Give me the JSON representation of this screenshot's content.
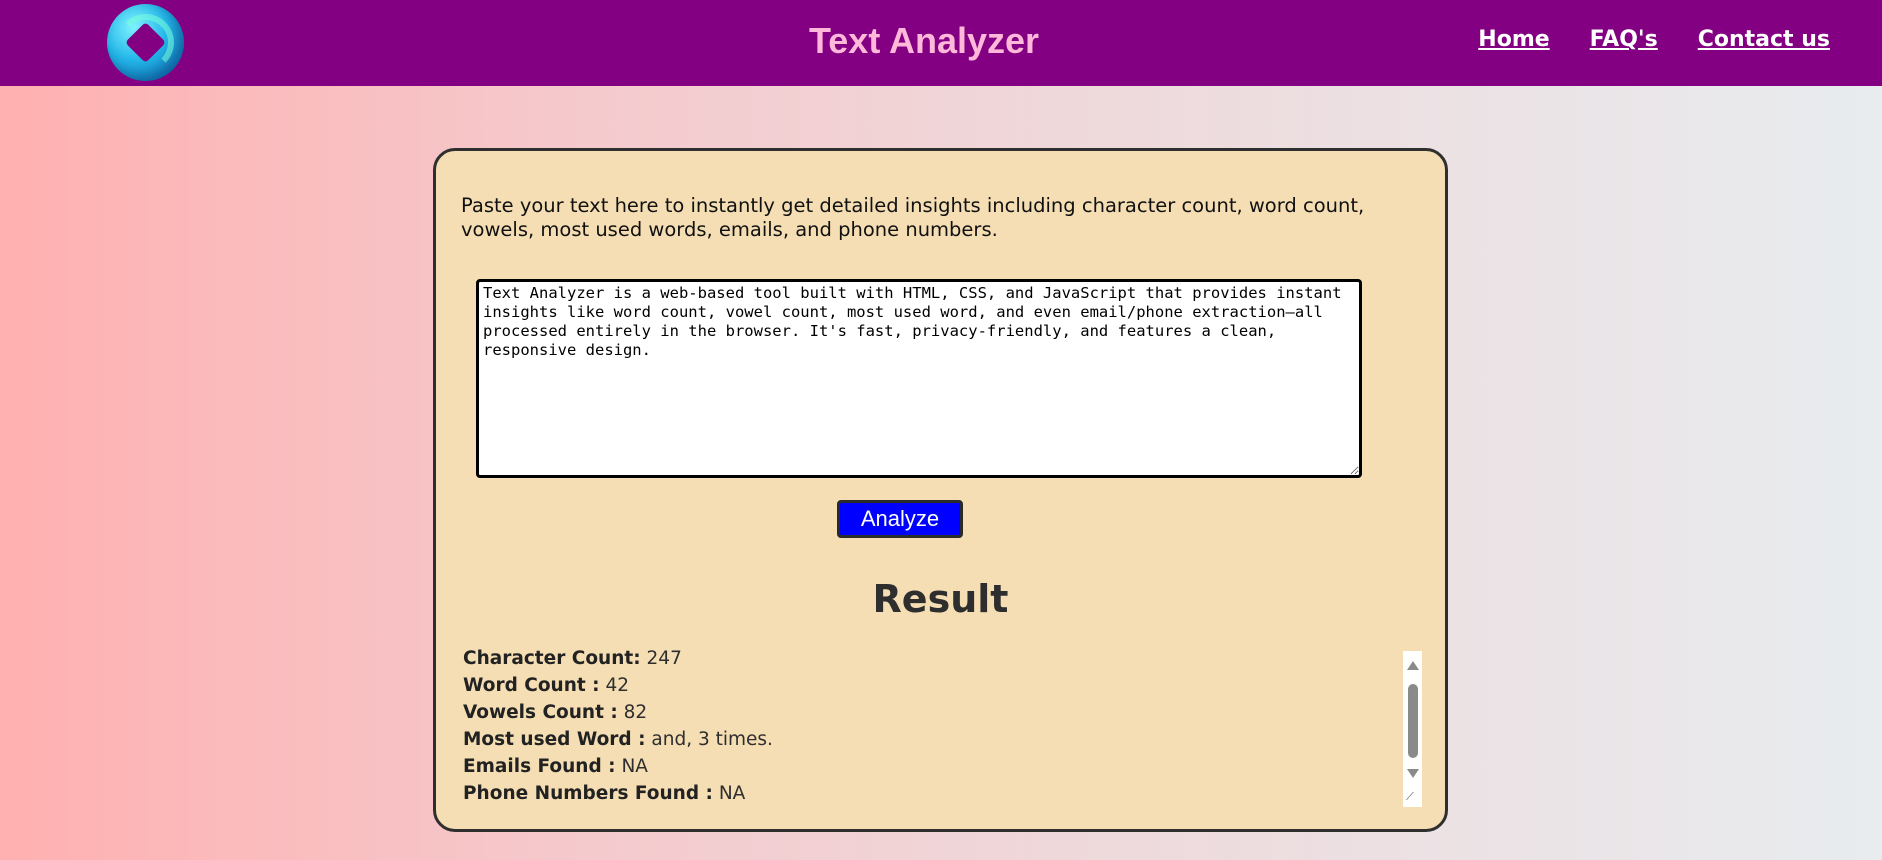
{
  "header": {
    "logo": "logo-icon",
    "title": "Text Analyzer",
    "nav": [
      "Home",
      "FAQ's",
      "Contact us"
    ]
  },
  "analyzer": {
    "intro": "Paste your text here to instantly get detailed insights including character count, word count, vowels, most used words, emails, and phone numbers.",
    "input_value": "Text Analyzer is a web-based tool built with HTML, CSS, and JavaScript that provides instant insights like word count, vowel count, most used word, and even email/phone extraction—all processed entirely in the browser. It's fast, privacy-friendly, and features a clean, responsive design.",
    "analyze_label": "Analyze"
  },
  "result": {
    "title": "Result",
    "items": [
      {
        "label": "Character Count:",
        "value": "247"
      },
      {
        "label": "Word Count :",
        "value": "42"
      },
      {
        "label": "Vowels Count :",
        "value": "82"
      },
      {
        "label": "Most used Word :",
        "value": "and, 3 times."
      },
      {
        "label": "Emails Found :",
        "value": "NA"
      },
      {
        "label": "Phone Numbers Found :",
        "value": "NA"
      }
    ]
  },
  "colors": {
    "navbar": "#820081",
    "title": "#ffb8d9",
    "card": "#f5deb3",
    "button": "#0000ff"
  }
}
